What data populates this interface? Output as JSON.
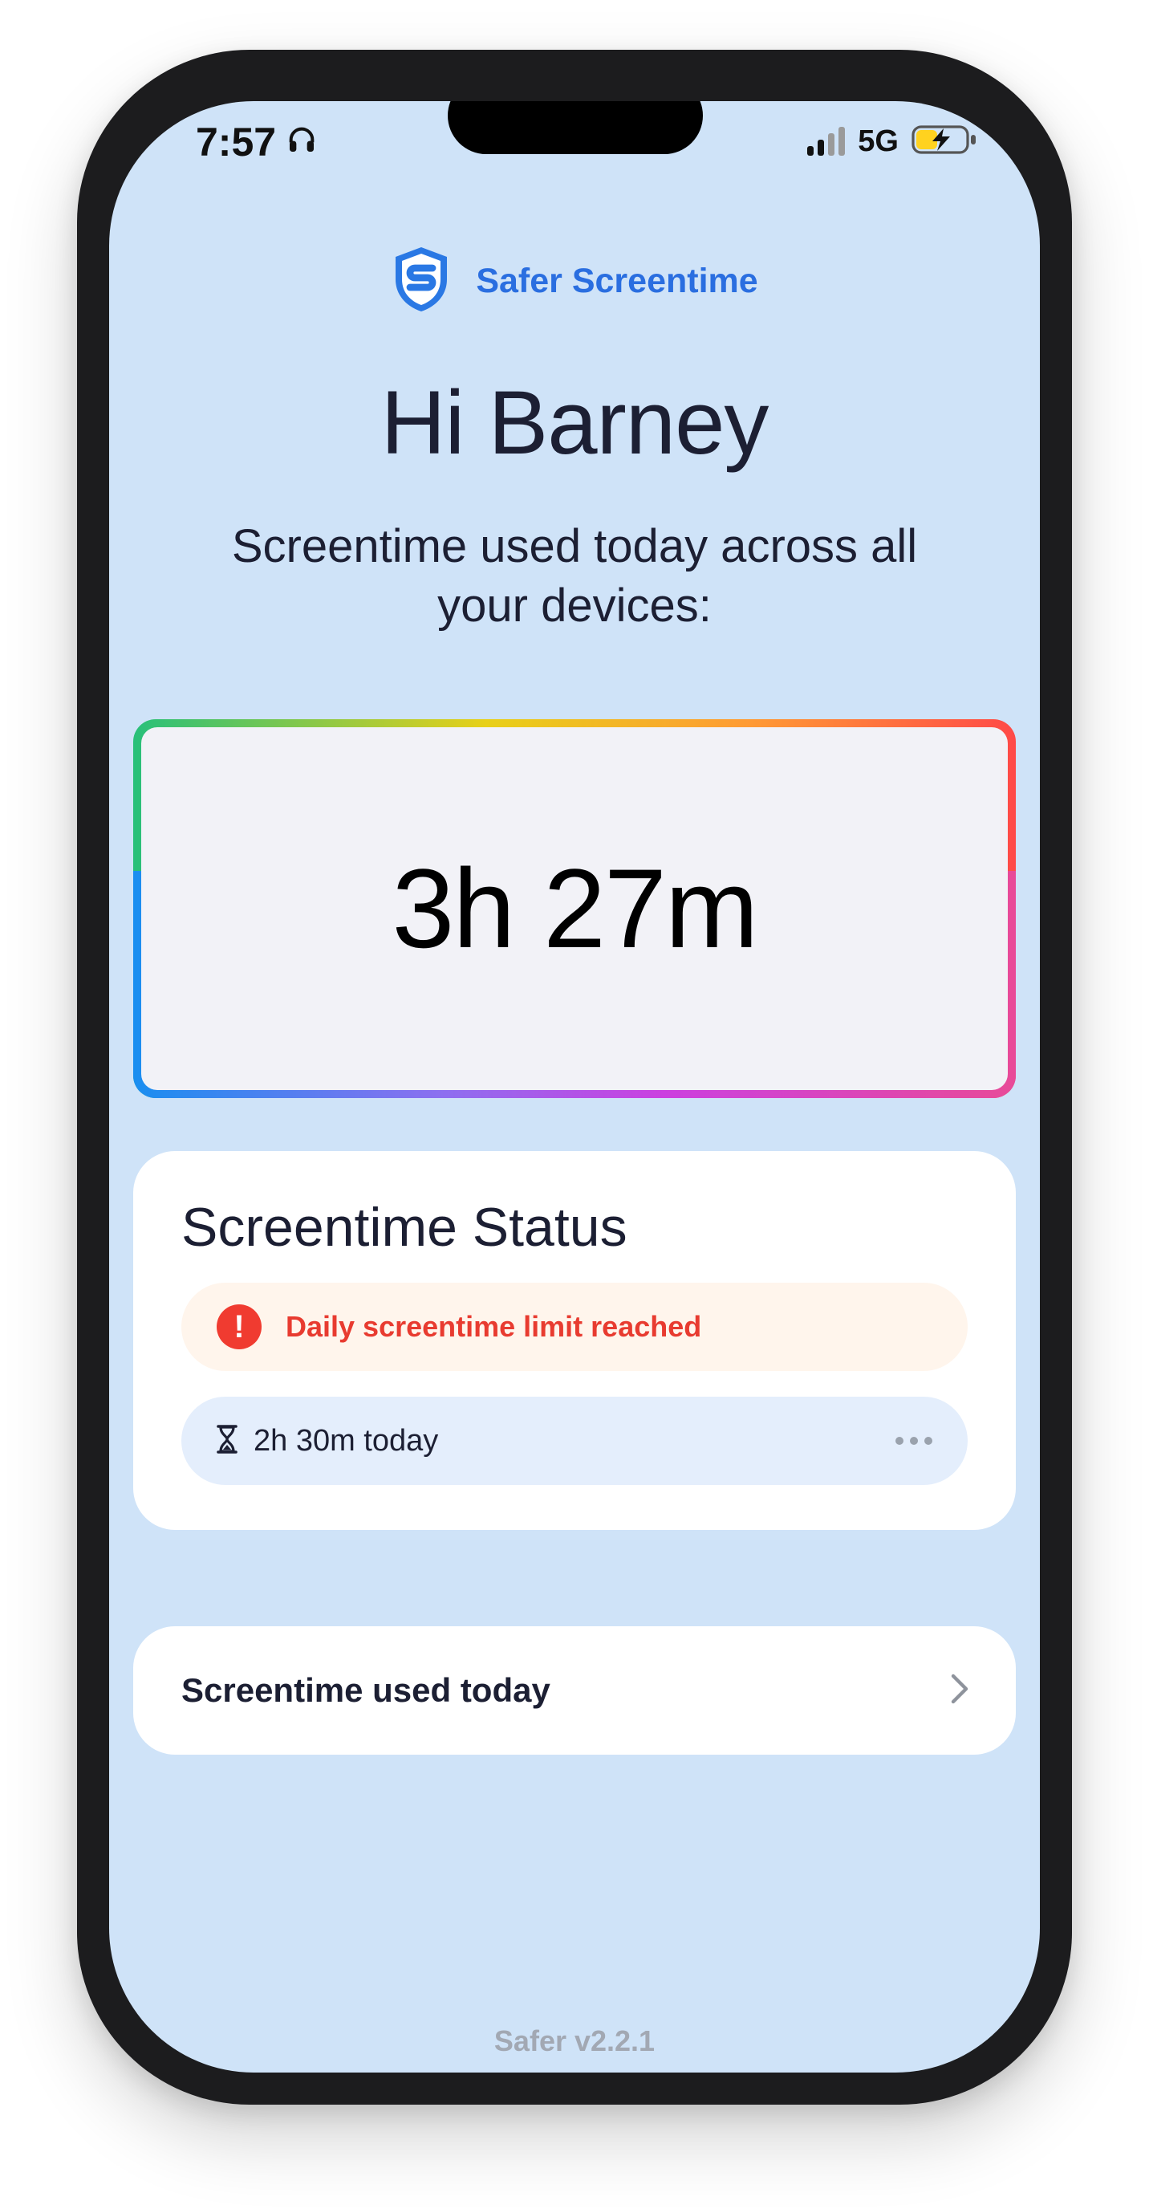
{
  "status_bar": {
    "time": "7:57",
    "network": "5G",
    "headphones_icon": "headphones-icon",
    "battery_icon": "battery-charging-icon"
  },
  "brand": {
    "name": "Safer Screentime",
    "logo_icon": "shield-s-icon",
    "color": "#2a6ee0"
  },
  "greeting": "Hi Barney",
  "subtitle": "Screentime used today across all your devices:",
  "total_time": "3h 27m",
  "status_card": {
    "title": "Screentime Status",
    "alert_text": "Daily screentime limit reached",
    "alert_icon": "exclamation-icon",
    "alert_color": "#e83b30",
    "usage_text": "2h 30m today",
    "usage_icon": "hourglass-icon",
    "more_icon": "more-dots-icon"
  },
  "used_today_row": {
    "label": "Screentime used today",
    "chevron_icon": "chevron-right-icon"
  },
  "version": "Safer v2.2.1"
}
